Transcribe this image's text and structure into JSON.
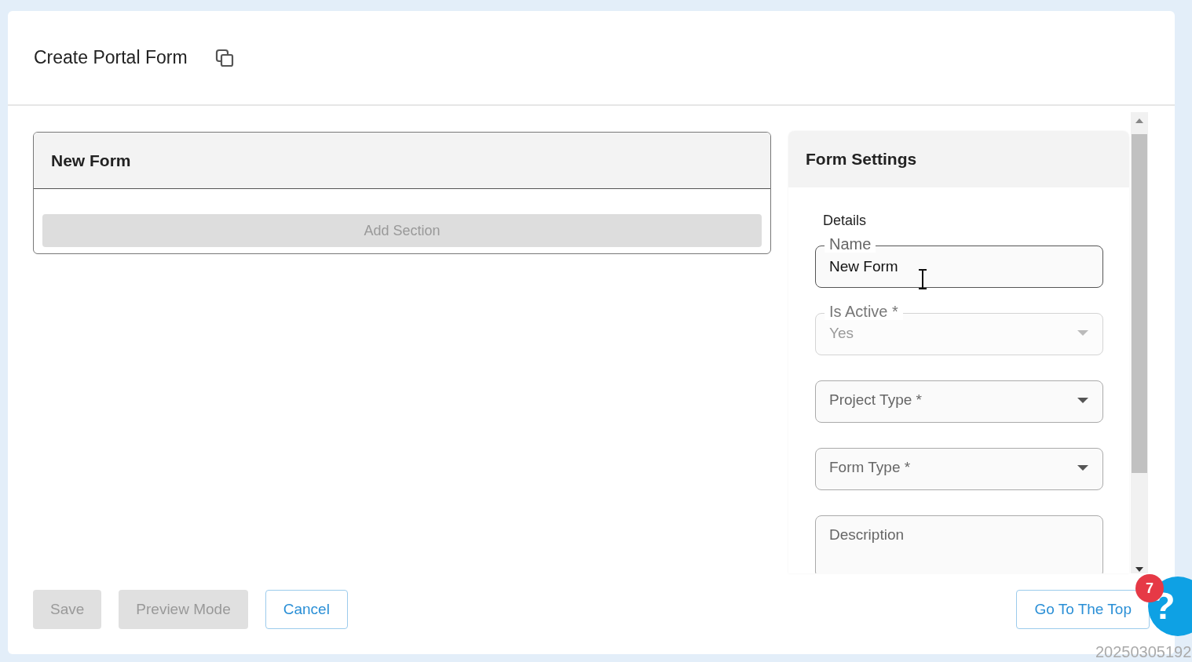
{
  "page": {
    "title": "Create Portal Form"
  },
  "form_panel": {
    "title": "New Form",
    "add_section_button": {
      "label": "Add Section",
      "disabled": true
    }
  },
  "settings_panel": {
    "title": "Form Settings",
    "section_label": "Details",
    "fields": [
      {
        "kind": "text",
        "label": "Name",
        "value": "New Form",
        "disabled": false,
        "focused": true
      },
      {
        "kind": "select",
        "label": "Is Active *",
        "value": "Yes",
        "disabled": true,
        "focused": false
      },
      {
        "kind": "select",
        "label": "Project Type *",
        "disabled": false,
        "focused": false
      },
      {
        "kind": "select",
        "label": "Form Type *",
        "disabled": false,
        "focused": false
      },
      {
        "kind": "textarea",
        "label": "Description",
        "disabled": false,
        "focused": false
      }
    ]
  },
  "footer": {
    "buttons": [
      {
        "label": "Save",
        "kind": "filled",
        "disabled": true
      },
      {
        "label": "Preview Mode",
        "kind": "filled",
        "disabled": true
      },
      {
        "label": "Cancel",
        "kind": "outline",
        "disabled": false
      }
    ],
    "go_top_button": {
      "label": "Go To The Top"
    }
  },
  "help_button": {
    "label": "?",
    "badge": "7"
  },
  "timestamp": "20250305192"
}
